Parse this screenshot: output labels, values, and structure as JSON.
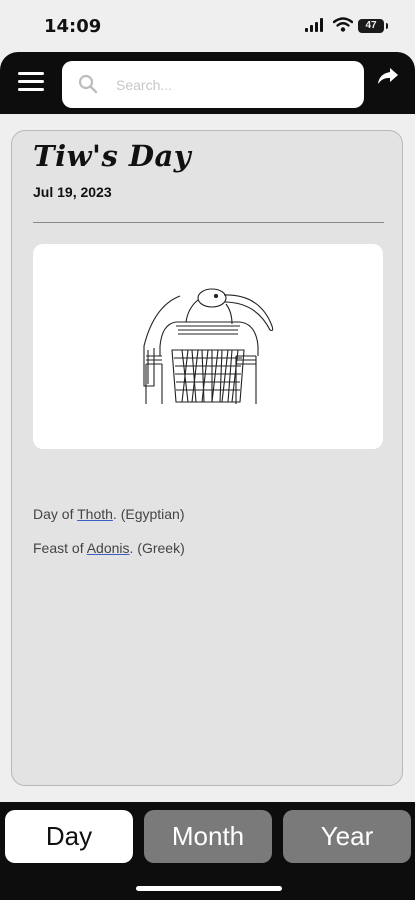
{
  "status_bar": {
    "time": "14:09",
    "battery": "47"
  },
  "search": {
    "placeholder": "Search..."
  },
  "card": {
    "title": "Tiw's Day",
    "date": "Jul 19, 2023",
    "image": "thoth-illustration",
    "entries": [
      {
        "prefix": "Day of ",
        "link": "Thoth",
        "suffix": ". (Egyptian)"
      },
      {
        "prefix": "Feast of ",
        "link": "Adonis",
        "suffix": ". (Greek)"
      }
    ]
  },
  "tabs": [
    {
      "label": "Day",
      "active": true
    },
    {
      "label": "Month",
      "active": false
    },
    {
      "label": "Year",
      "active": false
    }
  ],
  "icons": {
    "menu": "hamburger-icon",
    "search": "search-icon",
    "share": "share-arrow-icon"
  },
  "colors": {
    "header": "#0d0d0d",
    "card": "#e3e3e3",
    "tab_inactive": "#7a7a7a",
    "link_underline": "#3b5fc0"
  }
}
